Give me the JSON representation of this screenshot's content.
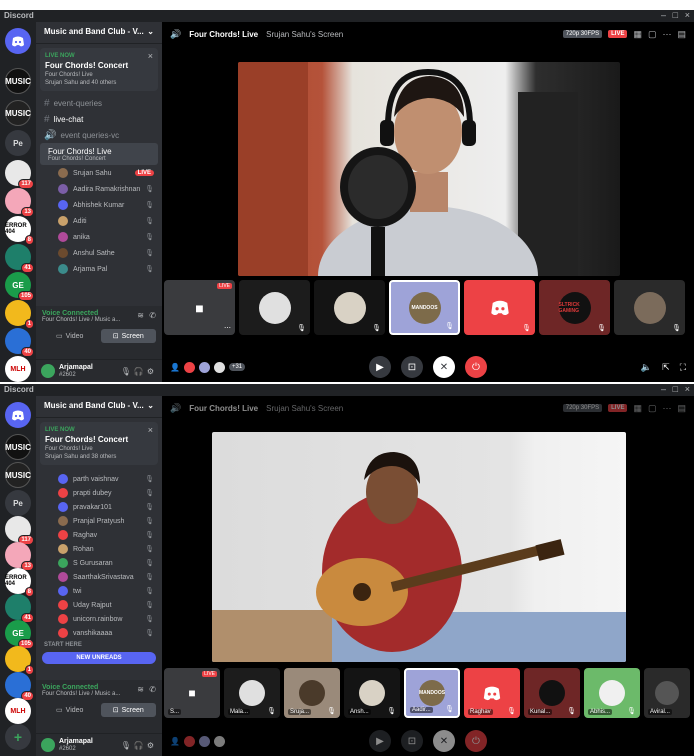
{
  "shots": [
    {
      "app_brand": "Discord",
      "server_name": "Music and Band Club - V...",
      "live_card": {
        "live_now": "LIVE NOW",
        "title": "Four Chords! Concert",
        "stage_name": "Four Chords! Live",
        "speakers": "Srujan Sahu and 40 others"
      },
      "channels": [
        {
          "name": "event-queries",
          "type": "text"
        },
        {
          "name": "live-chat",
          "type": "text"
        },
        {
          "name": "event queries-vc",
          "type": "voice"
        }
      ],
      "active_channel": {
        "name": "Four Chords! Live",
        "topic": "Four Chords! Concert"
      },
      "voice_users": [
        "Srujan Sahu",
        "Aadira Ramakrishnan",
        "Abhishek Kumar",
        "Aditi",
        "anika",
        "Anshul Sathe",
        "Arjama Pal"
      ],
      "live_badge": "LIVE",
      "voice_connected": {
        "title": "Voice Connected",
        "subtitle": "Four Chords! Live / Music a..."
      },
      "video_label": "Video",
      "screen_label": "Screen",
      "user": {
        "name": "Arjamapal",
        "tag": "#2602"
      },
      "guild_badges": [
        "117",
        "13",
        "8",
        "41",
        "105",
        "1",
        "40"
      ],
      "stage_header": {
        "title": "Four Chords! Live",
        "sharer": "Srujan Sahu's Screen",
        "quality": "720p 30FPS",
        "live": "LIVE"
      },
      "tiles": [
        {
          "name": "",
          "live": "LIVE"
        },
        {
          "name": ""
        },
        {
          "name": ""
        },
        {
          "name": "",
          "label": "MANDOOS"
        },
        {
          "name": ""
        },
        {
          "name": "",
          "label": "SLTRICK GAMING"
        },
        {
          "name": ""
        }
      ],
      "participant_count": "+31"
    },
    {
      "app_brand": "Discord",
      "server_name": "Music and Band Club - V...",
      "live_card": {
        "live_now": "LIVE NOW",
        "title": "Four Chords! Concert",
        "stage_name": "Four Chords! Live",
        "speakers": "Srujan Sahu and 38 others"
      },
      "voice_users": [
        "parth vaishnav",
        "prapti dubey",
        "pravakar101",
        "Pranjal Pratyush",
        "Raghav",
        "Rohan",
        "S Gurusaran",
        "SaarthakSrivastava",
        "twi",
        "Uday Rajput",
        "unicorn.rainbow",
        "vanshikaaaa"
      ],
      "start_here": "START HERE",
      "new_unreads": "NEW UNREADS",
      "voice_connected": {
        "title": "Voice Connected",
        "subtitle": "Four Chords! Live / Music a..."
      },
      "video_label": "Video",
      "screen_label": "Screen",
      "user": {
        "name": "Arjamapal",
        "tag": "#2602"
      },
      "guild_badges": [
        "117",
        "13",
        "8",
        "41",
        "105",
        "1",
        "40"
      ],
      "stage_header": {
        "title": "Four Chords! Live",
        "sharer": "Srujan Sahu's Screen",
        "quality": "720p 30FPS",
        "live": "LIVE"
      },
      "tiles": [
        {
          "name": "S...",
          "live": "LIVE"
        },
        {
          "name": "Mala..."
        },
        {
          "name": "Sruja..."
        },
        {
          "name": "Ansh..."
        },
        {
          "name": "Aadir...",
          "label": "MANDOOS"
        },
        {
          "name": "Raghav"
        },
        {
          "name": "Kunal..."
        },
        {
          "name": "Abhis..."
        },
        {
          "name": "Aviral..."
        }
      ]
    }
  ],
  "colors": {
    "blurple": "#5865f2",
    "green": "#3ba55d",
    "red": "#ed4245",
    "sidebar": "#2f3136",
    "rail": "#202225"
  }
}
